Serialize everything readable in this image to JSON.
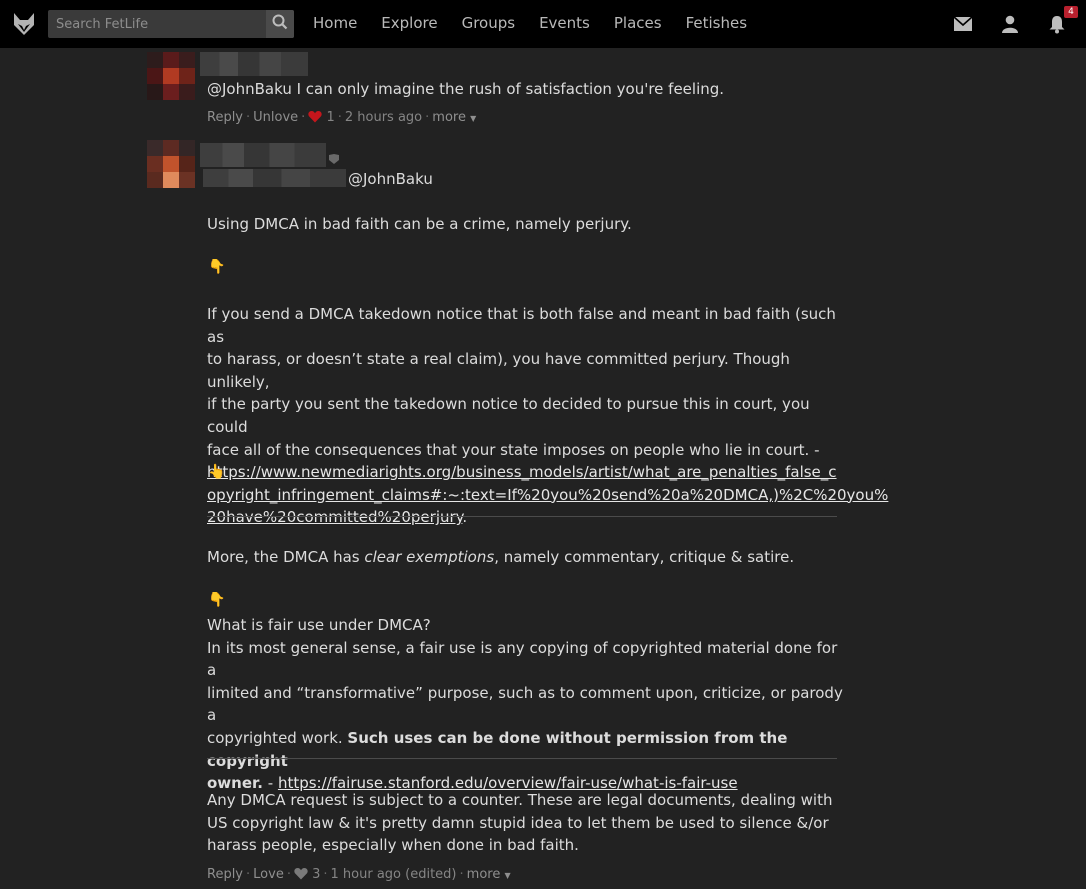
{
  "topnav": {
    "search_placeholder": "Search FetLife",
    "items": [
      "Home",
      "Explore",
      "Groups",
      "Events",
      "Places",
      "Fetishes"
    ],
    "notification_count": "4"
  },
  "comment1": {
    "mention": "@JohnBaku",
    "text": " I can only imagine the rush of satisfaction you're feeling.",
    "actions": {
      "reply": "Reply",
      "love_toggle": "Unlove",
      "love_count": "1",
      "time": "2 hours ago",
      "more": "more"
    }
  },
  "comment2": {
    "mention": "@JohnBaku",
    "p1": "Using DMCA in bad faith can be a crime, namely perjury.",
    "point_down_1": "👇",
    "p2_lines": [
      "If you send a DMCA takedown notice that is both false and meant in bad faith (such as",
      "to harass, or doesn’t state a real claim), you have committed perjury. Though unlikely,",
      "if the party you sent the takedown notice to decided to pursue this in court, you could",
      "face all of the consequences that your state imposes on people who lie in court. -"
    ],
    "link1_lines": [
      "https://www.newmediarights.org/business_models/artist/what_are_penalties_false_c",
      "opyright_infringement_claims#:~:text=If%20you%20send%20a%20DMCA,)%2C%20you%",
      "20have%20committed%20perjury"
    ],
    "link1_end": ".",
    "point_up_1": "👆",
    "p3_before": "More, the DMCA has ",
    "p3_italic": "clear exemptions",
    "p3_after": ", namely commentary, critique & satire.",
    "point_down_2": "👇",
    "p4_heading": "What is fair use under DMCA?",
    "p4_line1": "In its most general sense, a fair use is any copying of copyrighted material done for a",
    "p4_line2": "limited and “transformative” purpose, such as to comment upon, criticize, or parody a",
    "p4_line3_plain": "copyrighted work. ",
    "p4_line3_bold": "Such uses can be done without permission from the copyright",
    "p4_line4_bold": "owner.",
    "p4_line4_dash": " - ",
    "link2": "https://fairuse.stanford.edu/overview/fair-use/what-is-fair-use",
    "p5_lines": [
      "Any DMCA request is subject to a counter. These are legal documents, dealing with",
      "US copyright law & it's pretty damn stupid idea to let them be used to silence &/or",
      "harass people, especially when done in bad faith."
    ],
    "actions": {
      "reply": "Reply",
      "love_toggle": "Love",
      "love_count": "3",
      "time": "1 hour ago (edited)",
      "more": "more"
    }
  },
  "colors": {
    "background": "#222222",
    "topbar": "#000000",
    "badge": "#b8202e",
    "loved_heart": "#c4161c",
    "unloved_heart": "#7a7a7a"
  }
}
